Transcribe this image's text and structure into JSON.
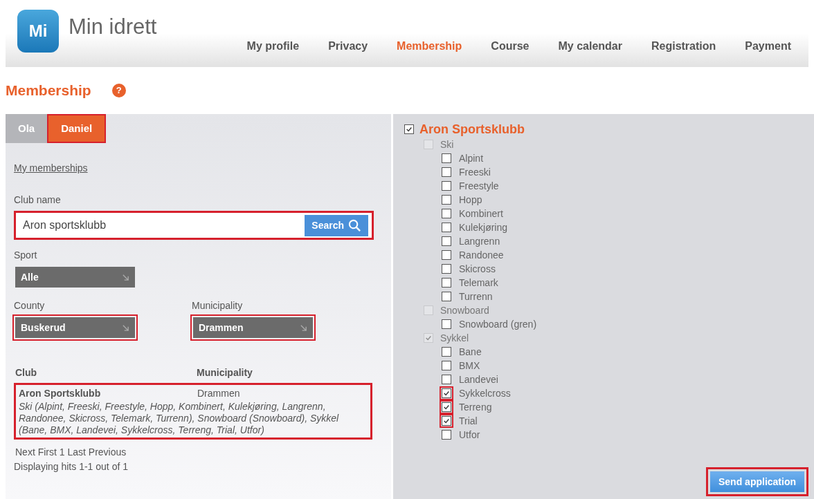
{
  "header": {
    "logo_mark": "Mi",
    "logo_text": "Min idrett",
    "nav": [
      {
        "label": "My profile",
        "selected": false
      },
      {
        "label": "Privacy",
        "selected": false
      },
      {
        "label": "Membership",
        "selected": true
      },
      {
        "label": "Course",
        "selected": false
      },
      {
        "label": "My calendar",
        "selected": false
      },
      {
        "label": "Registration",
        "selected": false
      },
      {
        "label": "Payment",
        "selected": false
      }
    ]
  },
  "page_title": "Membership",
  "help": "?",
  "person_tabs": [
    {
      "label": "Ola",
      "selected": false,
      "highlighted": false
    },
    {
      "label": "Daniel",
      "selected": true,
      "highlighted": true
    }
  ],
  "my_memberships_link": "My memberships",
  "club_search": {
    "label": "Club name",
    "value": "Aron sportsklubb",
    "button": "Search",
    "highlighted": true
  },
  "filters": [
    {
      "label": "Sport",
      "value": "Alle",
      "highlighted": false
    },
    {
      "label": "County",
      "value": "Buskerud",
      "highlighted": true
    },
    {
      "label": "Municipality",
      "value": "Drammen",
      "highlighted": true
    }
  ],
  "results": {
    "columns": [
      "Club",
      "Municipality"
    ],
    "rows": [
      {
        "club": "Aron Sportsklubb",
        "municipality": "Drammen",
        "sports": "Ski (Alpint, Freeski, Freestyle, Hopp, Kombinert, Kulekjøring, Langrenn, Randonee, Skicross, Telemark, Turrenn), Snowboard (Snowboard), Sykkel (Bane, BMX, Landevei, Sykkelcross, Terreng, Trial, Utfor)",
        "highlighted": true
      }
    ],
    "pager": "Next First 1 Last Previous",
    "summary": "Displaying hits 1-1 out of 1"
  },
  "club_tree": {
    "name": "Aron Sportsklubb",
    "checked": true,
    "children": [
      {
        "label": "Ski",
        "checked": false,
        "disabled": true,
        "children": [
          {
            "label": "Alpint",
            "checked": false,
            "highlighted": false
          },
          {
            "label": "Freeski",
            "checked": false,
            "highlighted": false
          },
          {
            "label": "Freestyle",
            "checked": false,
            "highlighted": false
          },
          {
            "label": "Hopp",
            "checked": false,
            "highlighted": false
          },
          {
            "label": "Kombinert",
            "checked": false,
            "highlighted": false
          },
          {
            "label": "Kulekjøring",
            "checked": false,
            "highlighted": false
          },
          {
            "label": "Langrenn",
            "checked": false,
            "highlighted": false
          },
          {
            "label": "Randonee",
            "checked": false,
            "highlighted": false
          },
          {
            "label": "Skicross",
            "checked": false,
            "highlighted": false
          },
          {
            "label": "Telemark",
            "checked": false,
            "highlighted": false
          },
          {
            "label": "Turrenn",
            "checked": false,
            "highlighted": false
          }
        ]
      },
      {
        "label": "Snowboard",
        "checked": false,
        "disabled": true,
        "children": [
          {
            "label": "Snowboard (gren)",
            "checked": false,
            "highlighted": false
          }
        ]
      },
      {
        "label": "Sykkel",
        "checked": true,
        "disabled": true,
        "children": [
          {
            "label": "Bane",
            "checked": false,
            "highlighted": false
          },
          {
            "label": "BMX",
            "checked": false,
            "highlighted": false
          },
          {
            "label": "Landevei",
            "checked": false,
            "highlighted": false
          },
          {
            "label": "Sykkelcross",
            "checked": true,
            "highlighted": true
          },
          {
            "label": "Terreng",
            "checked": true,
            "highlighted": true
          },
          {
            "label": "Trial",
            "checked": true,
            "highlighted": true
          },
          {
            "label": "Utfor",
            "checked": false,
            "highlighted": false
          }
        ]
      }
    ]
  },
  "send_button": {
    "label": "Send application",
    "highlighted": true
  }
}
